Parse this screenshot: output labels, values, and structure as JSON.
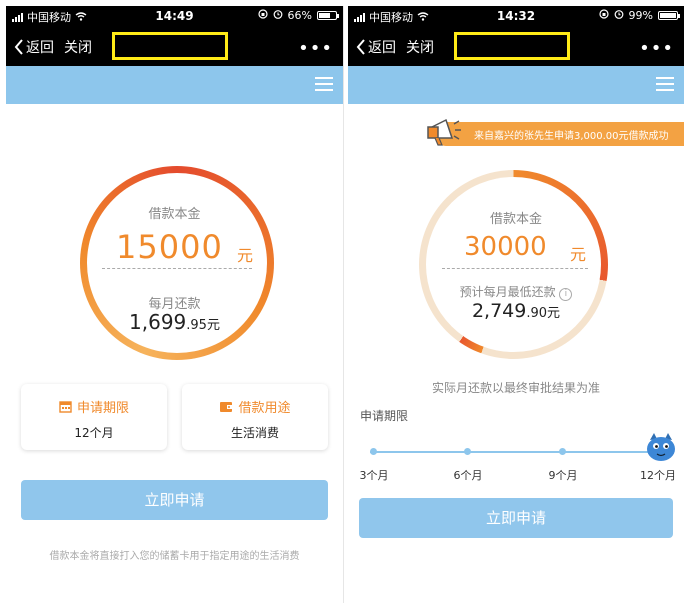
{
  "left": {
    "status": {
      "carrier": "中国移动",
      "time": "14:49",
      "battery": "66%",
      "battery_level": 0.66
    },
    "nav": {
      "back": "返回",
      "close": "关闭",
      "more": "•••"
    },
    "loan_label": "借款本金",
    "amount": "15000",
    "unit": "元",
    "monthly_label": "每月还款",
    "monthly_main": "1,699",
    "monthly_decimal": ".95",
    "monthly_unit": "元",
    "term_card": {
      "title": "申请期限",
      "value": "12个月",
      "icon": "calendar-icon"
    },
    "purpose_card": {
      "title": "借款用途",
      "value": "生活消费",
      "icon": "wallet-icon"
    },
    "apply_button": "立即申请",
    "footnote": "借款本金将直接打入您的储蓄卡用于指定用途的生活消费"
  },
  "right": {
    "status": {
      "carrier": "中国移动",
      "time": "14:32",
      "battery": "99%",
      "battery_level": 0.99
    },
    "nav": {
      "back": "返回",
      "close": "关闭",
      "more": "•••"
    },
    "banner": "来自嘉兴的张先生申请3,000.00元借款成功",
    "loan_label": "借款本金",
    "amount": "30000",
    "unit": "元",
    "monthly_label": "预计每月最低还款",
    "monthly_main": "2,749",
    "monthly_decimal": ".90",
    "monthly_unit": "元",
    "notice": "实际月还款以最终审批结果为准",
    "term_label": "申请期限",
    "ticks": [
      "3个月",
      "6个月",
      "9个月",
      "12个月"
    ],
    "selected_term": "12个月",
    "apply_button": "立即申请"
  },
  "colors": {
    "accent": "#f08a2c",
    "blue": "#8dc6ec",
    "button": "#90c6ec"
  }
}
